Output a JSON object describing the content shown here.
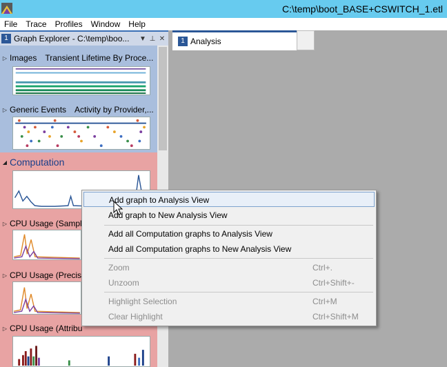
{
  "window": {
    "title": "C:\\temp\\boot_BASE+CSWITCH_1.etl"
  },
  "menu": [
    "File",
    "Trace",
    "Profiles",
    "Window",
    "Help"
  ],
  "explorer": {
    "number": "1",
    "title": "Graph Explorer - C:\\temp\\boo...",
    "sections": [
      {
        "label": "Images",
        "preset": "Transient Lifetime By Proce..."
      },
      {
        "label": "Generic Events",
        "preset": "Activity by Provider,..."
      },
      {
        "label": "Computation"
      },
      {
        "label": "CPU Usage (Sampl"
      },
      {
        "label": "CPU Usage (Precise"
      },
      {
        "label": "CPU Usage (Attribu"
      }
    ]
  },
  "tab": {
    "number": "1",
    "label": "Analysis"
  },
  "context_menu": {
    "items": [
      {
        "label": "Add graph to Analysis View",
        "shortcut": ""
      },
      {
        "label": "Add graph to New Analysis View",
        "shortcut": ""
      },
      {
        "label": "Add all Computation graphs to Analysis View",
        "shortcut": ""
      },
      {
        "label": "Add all Computation graphs to New Analysis View",
        "shortcut": ""
      },
      {
        "label": "Zoom",
        "shortcut": "Ctrl+."
      },
      {
        "label": "Unzoom",
        "shortcut": "Ctrl+Shift+-"
      },
      {
        "label": "Highlight Selection",
        "shortcut": "Ctrl+M"
      },
      {
        "label": "Clear Highlight",
        "shortcut": "Ctrl+Shift+M"
      }
    ]
  },
  "colors": {
    "titlebar": "#67cbef",
    "accent": "#2b5797",
    "section_blue": "#a9bedd",
    "section_red": "#e8a3a3"
  }
}
